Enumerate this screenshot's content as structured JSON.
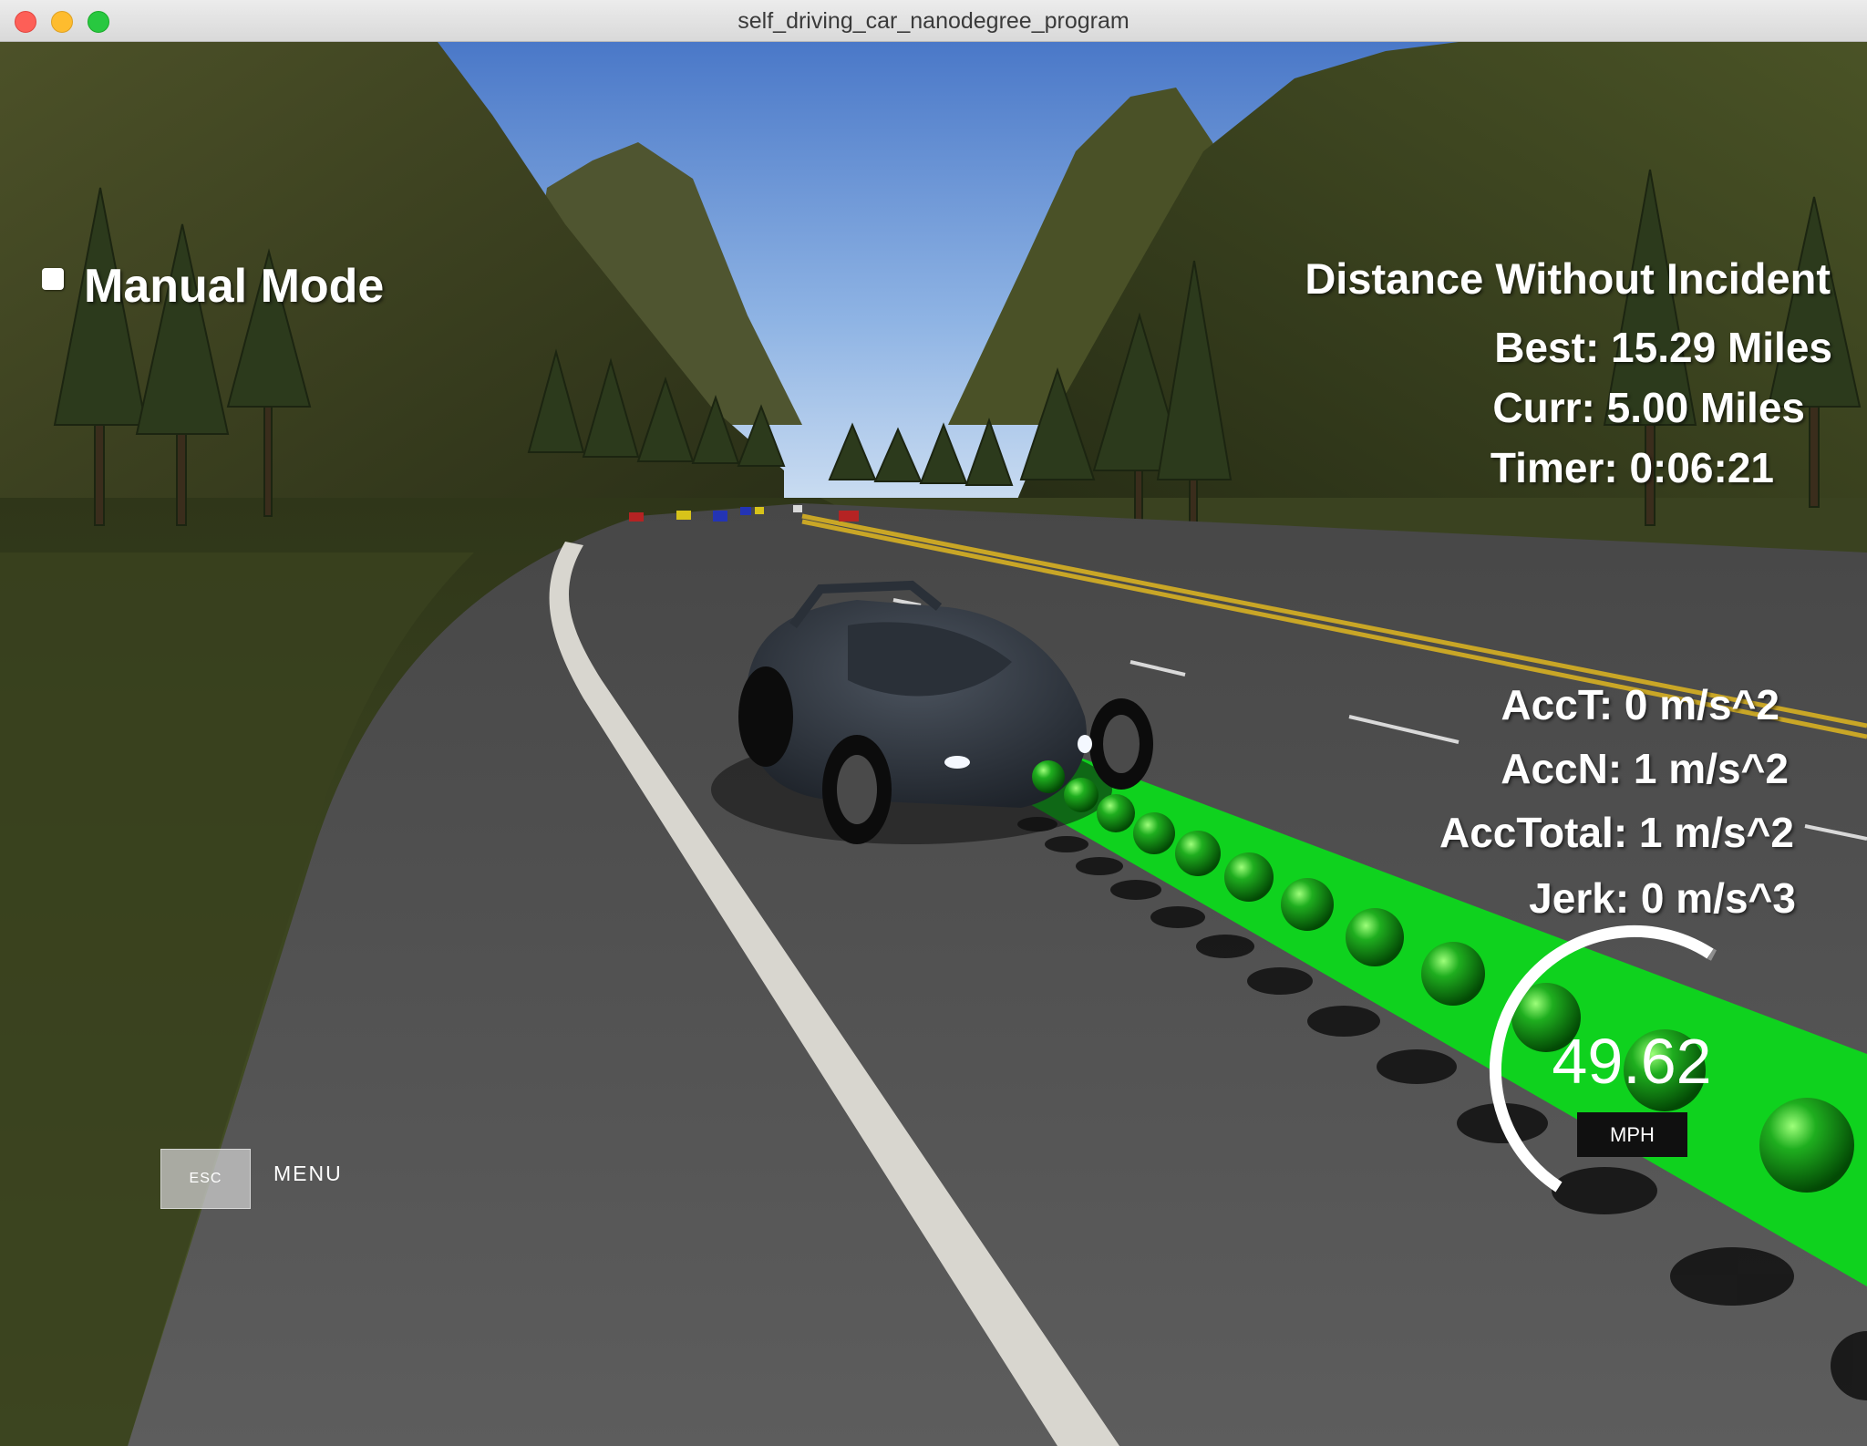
{
  "window": {
    "title": "self_driving_car_nanodegree_program"
  },
  "hud": {
    "manual_mode_label": "Manual Mode",
    "manual_mode_checked": false,
    "distance_title": "Distance Without Incident",
    "best": "Best: 15.29 Miles",
    "curr": "Curr: 5.00 Miles",
    "timer": "Timer: 0:06:21",
    "acc_t": "AccT: 0 m/s^2",
    "acc_n": "AccN: 1 m/s^2",
    "acc_total": "AccTotal: 1 m/s^2",
    "jerk": "Jerk: 0 m/s^3"
  },
  "speedometer": {
    "value": "49.62",
    "unit": "MPH"
  },
  "controls": {
    "esc_key": "ESC",
    "menu_label": "MENU"
  },
  "colors": {
    "trajectory": "#0fd21e",
    "sky_top": "#4a78c8",
    "sky_bottom": "#d6e6f5",
    "road": "#505050",
    "grass": "#3d4820"
  }
}
